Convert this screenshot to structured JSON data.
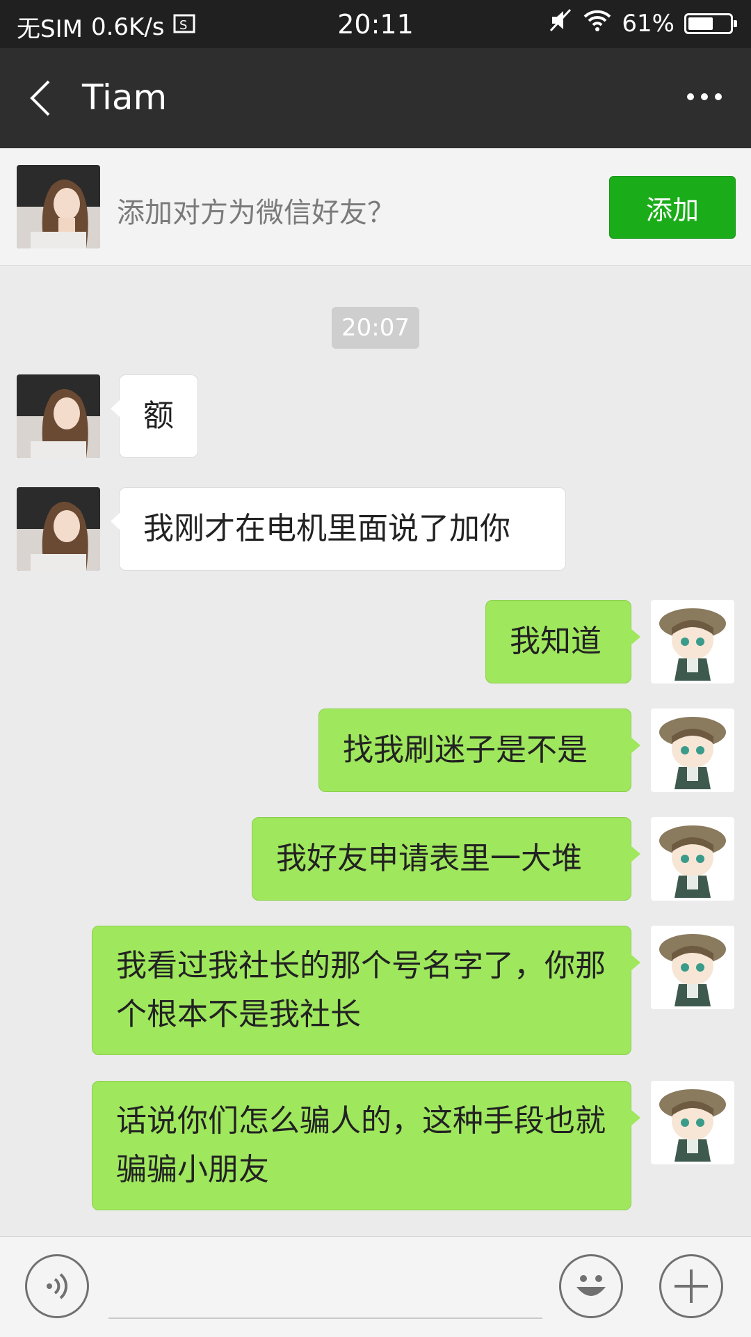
{
  "status_bar": {
    "carrier": "无SIM",
    "speed": "0.6K/s",
    "time": "20:11",
    "battery_text": "61%",
    "battery_level": 0.61
  },
  "header": {
    "title": "Tiam"
  },
  "add_banner": {
    "prompt": "添加对方为微信好友？",
    "button_label": "添加"
  },
  "chat": {
    "timestamp": "20:07",
    "messages": [
      {
        "side": "in",
        "text": "额"
      },
      {
        "side": "in",
        "text": "我刚才在电机里面说了加你"
      },
      {
        "side": "out",
        "text": "我知道"
      },
      {
        "side": "out",
        "text": "找我刷迷子是不是"
      },
      {
        "side": "out",
        "text": "我好友申请表里一大堆"
      },
      {
        "side": "out",
        "text": "我看过我社长的那个号名字了，你那个根本不是我社长"
      },
      {
        "side": "out",
        "text": "话说你们怎么骗人的，这种手段也就骗骗小朋友"
      }
    ]
  },
  "colors": {
    "out_bubble": "#9fe75d",
    "add_button": "#1aad19",
    "header_bg": "#2e2e2e"
  }
}
